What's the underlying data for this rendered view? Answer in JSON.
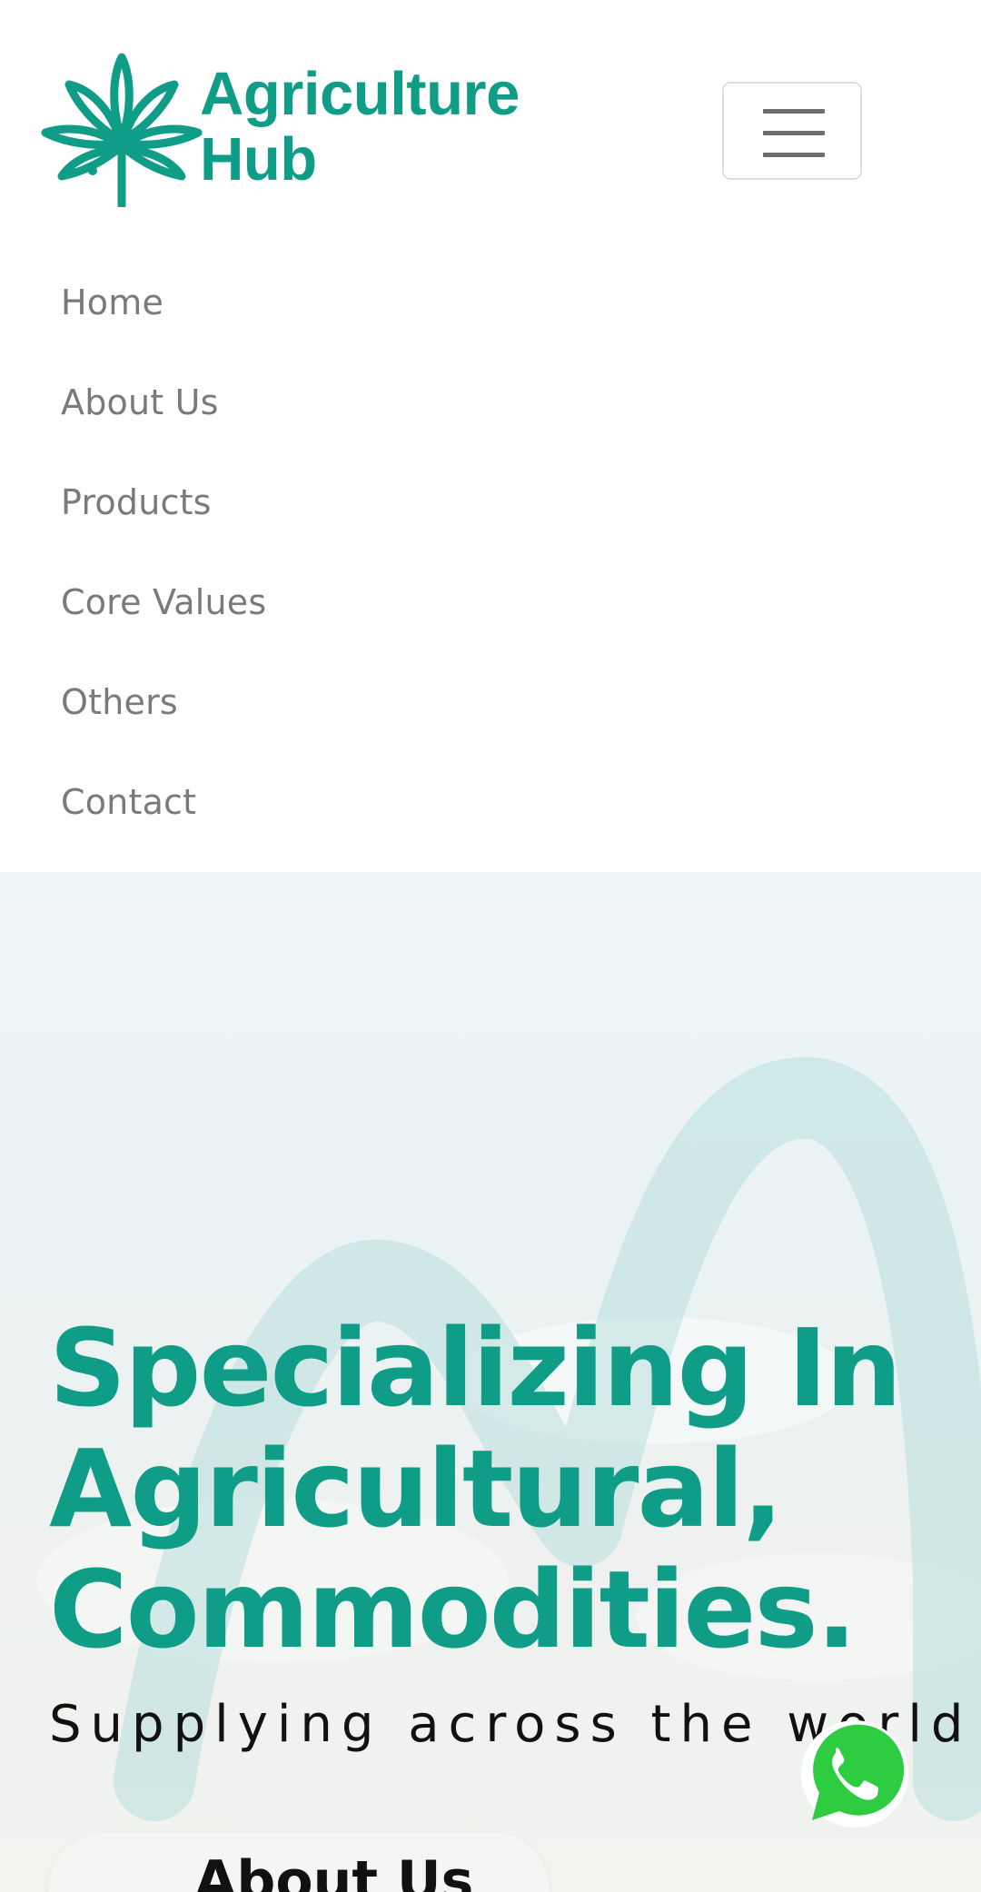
{
  "brand": {
    "line1": "Agriculture",
    "line2": "Hub",
    "color": "#0f9d87",
    "logo_icon": "cannabis-leaf-icon"
  },
  "header": {
    "menu_toggle_icon": "hamburger-menu-icon"
  },
  "nav": {
    "items": [
      {
        "label": "Home"
      },
      {
        "label": "About Us"
      },
      {
        "label": "Products"
      },
      {
        "label": "Core Values"
      },
      {
        "label": "Others"
      },
      {
        "label": "Contact"
      }
    ],
    "text_color": "#7a7a7a"
  },
  "hero": {
    "title_lines": [
      "Specializing In",
      "Agricultural,",
      "Commodities."
    ],
    "subtitle": "Supplying across the world",
    "button_label": "About Us",
    "title_color": "#0f9d87"
  },
  "floating": {
    "whatsapp_icon": "whatsapp-icon",
    "whatsapp_color": "#2ecc40"
  }
}
